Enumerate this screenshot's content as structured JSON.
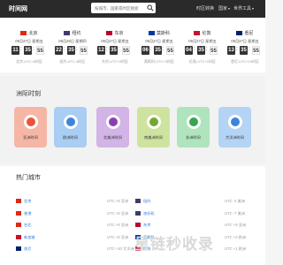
{
  "header": {
    "logo": "时间网",
    "search_placeholder": "按城市、国家或时区搜索",
    "nav": [
      {
        "label": "时区转换",
        "caret": ""
      },
      {
        "label": "国家",
        "caret": "▾"
      },
      {
        "label": "世界工具",
        "caret": "▾"
      }
    ]
  },
  "clocks": [
    {
      "city": "北京",
      "date": "09月27日 星期五",
      "hh": "11",
      "mm": "35",
      "ss": "55",
      "utc": "北京,UTC+8时区",
      "flag_color": "#de2910"
    },
    {
      "city": "纽约",
      "date": "09月26日 星期四",
      "hh": "22",
      "mm": "35",
      "ss": "55",
      "utc": "纽约,UTC-4时区",
      "flag_color": "#3c3b6e"
    },
    {
      "city": "东京",
      "date": "09月27日 星期五",
      "hh": "12",
      "mm": "35",
      "ss": "55",
      "utc": "东京,UTC+9时区",
      "flag_color": "#bc002d"
    },
    {
      "city": "莫斯科",
      "date": "09月27日 星期五",
      "hh": "06",
      "mm": "35",
      "ss": "55",
      "utc": "莫斯科,UTC+3时区",
      "flag_color": "#0039a6"
    },
    {
      "city": "伦敦",
      "date": "09月27日 星期五",
      "hh": "04",
      "mm": "35",
      "ss": "55",
      "utc": "伦敦,UTC+1时区",
      "flag_color": "#c8102e"
    },
    {
      "city": "悉尼",
      "date": "09月27日 星期五",
      "hh": "13",
      "mm": "35",
      "ss": "55",
      "utc": "悉尼,UTC+10时区",
      "flag_color": "#012169"
    }
  ],
  "continents": {
    "title": "洲际时刻",
    "items": [
      {
        "label": "亚洲时间",
        "bg": "#f6b6a6",
        "land": "#e8553b"
      },
      {
        "label": "欧洲时间",
        "bg": "#a9cdf3",
        "land": "#3c86d6"
      },
      {
        "label": "北美洲时间",
        "bg": "#d3b4e6",
        "land": "#8a3fb5"
      },
      {
        "label": "南美洲时间",
        "bg": "#cfe3a0",
        "land": "#76a730"
      },
      {
        "label": "非洲时间",
        "bg": "#b0e4bd",
        "land": "#36a656"
      },
      {
        "label": "大洋洲时间",
        "bg": "#b5d4f5",
        "land": "#3b84d8"
      }
    ]
  },
  "hot_cities": {
    "title": "热门城市",
    "rows": [
      {
        "left": {
          "flag": "#de2910",
          "name": "北京",
          "tz": "UTC +8 亚洲"
        },
        "right": {
          "flag": "#3c3b6e",
          "name": "纽约",
          "tz": "UTC -4 美洲"
        }
      },
      {
        "left": {
          "flag": "#de2910",
          "name": "香港",
          "tz": "UTC +8 亚洲"
        },
        "right": {
          "flag": "#3c3b6e",
          "name": "洛杉矶",
          "tz": "UTC -7 美洲"
        }
      },
      {
        "left": {
          "flag": "#de2910",
          "name": "台北",
          "tz": "UTC +8 亚洲"
        },
        "right": {
          "flag": "#bc002d",
          "name": "东京",
          "tz": "UTC +9 亚洲"
        }
      },
      {
        "left": {
          "flag": "#c8102e",
          "name": "新加坡",
          "tz": "UTC +8 亚洲"
        },
        "right": {
          "flag": "#0039a6",
          "name": "莫斯科",
          "tz": "UTC +3 欧洲"
        }
      },
      {
        "left": {
          "flag": "#012169",
          "name": "悉尼",
          "tz": "UTC +10 大洋洲"
        },
        "right": {
          "flag": "#c8102e",
          "name": "伦敦",
          "tz": "UTC +1 欧洲"
        }
      }
    ]
  },
  "watermark": "星链秒收录"
}
